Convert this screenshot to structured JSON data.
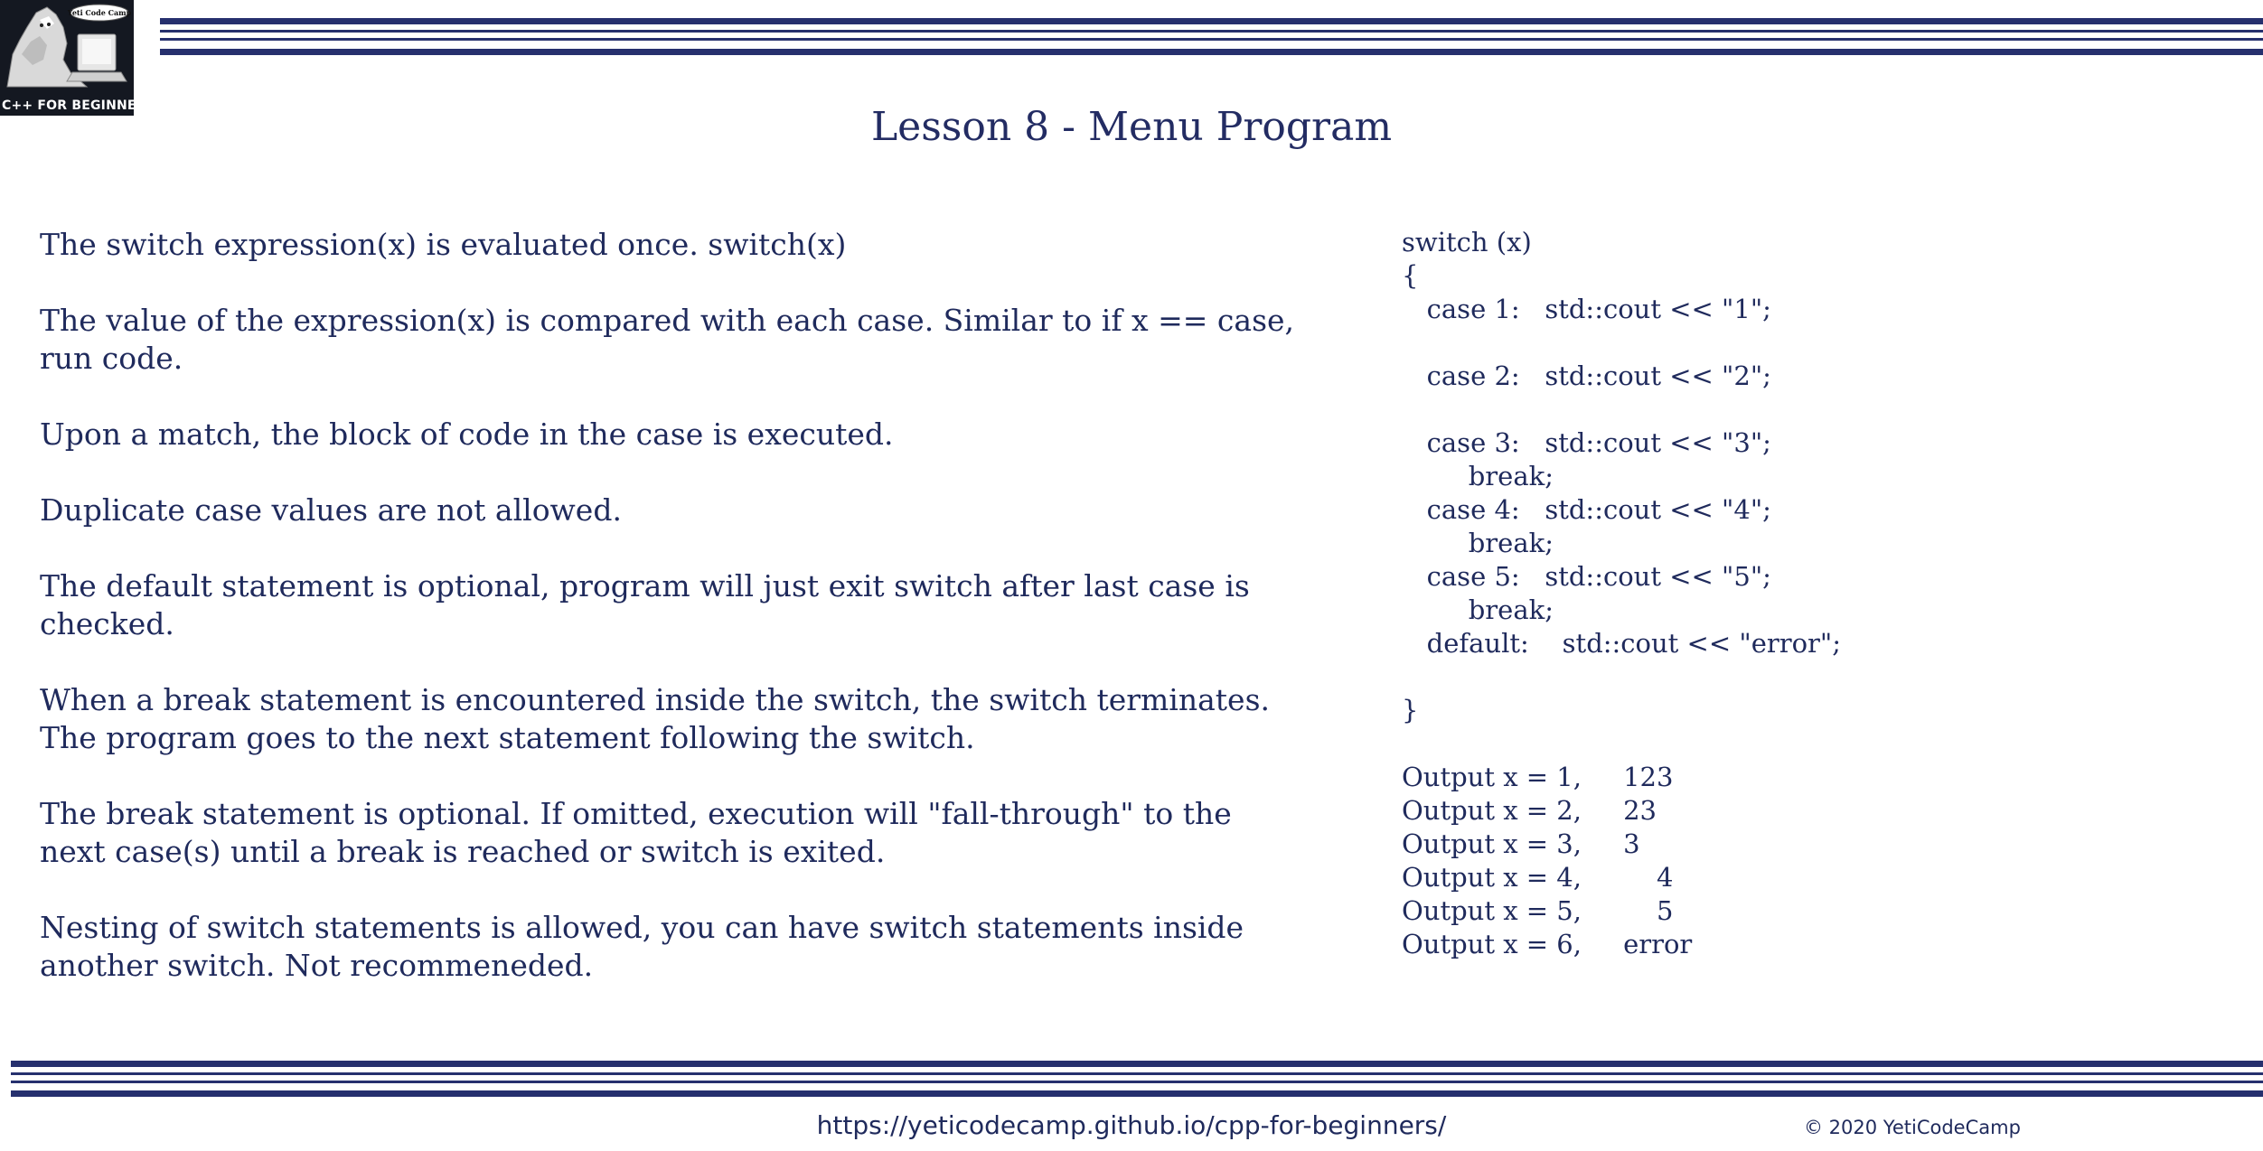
{
  "logo": {
    "badge_text": "Yeti Code Camp",
    "caption": "C++ FOR BEGINNERS"
  },
  "title": "Lesson 8 - Menu Program",
  "paragraphs": [
    "The switch expression(x) is evaluated once.   switch(x)",
    "The value of the expression(x) is compared with each case. Similar to if x == case, run code.",
    "Upon a match, the block of code in the case is executed.",
    "Duplicate case values are not allowed.",
    "The default statement is optional, program will just exit switch after last case is checked.",
    "When a break statement is encountered inside the switch, the switch terminates. The program goes to the next statement following the switch.",
    "The break statement is optional. If omitted, execution will \"fall-through\" to the next case(s) until a break is reached or switch is exited.",
    "Nesting of switch statements is allowed, you can have switch statements inside another switch. Not recommeneded."
  ],
  "code_lines": [
    "switch (x)",
    "{",
    "   case 1:   std::cout << \"1\";",
    "",
    "   case 2:   std::cout << \"2\";",
    "",
    "   case 3:   std::cout << \"3\";",
    "        break;",
    "   case 4:   std::cout << \"4\";",
    "        break;",
    "   case 5:   std::cout << \"5\";",
    "        break;",
    "   default:    std::cout << \"error\";",
    "",
    "}"
  ],
  "output_lines": [
    "Output x = 1,     123",
    "Output x = 2,     23",
    "Output x = 3,     3",
    "Output x = 4,         4",
    "Output x = 5,         5",
    "Output x = 6,     error"
  ],
  "footer": {
    "url": "https://yeticodecamp.github.io/cpp-for-beginners/",
    "copyright": "© 2020 YetiCodeCamp"
  },
  "colors": {
    "accent": "#26306e",
    "text": "#1f2a5c",
    "logo_background": "#141821"
  },
  "icons": [
    "yeti-logo-icon"
  ]
}
